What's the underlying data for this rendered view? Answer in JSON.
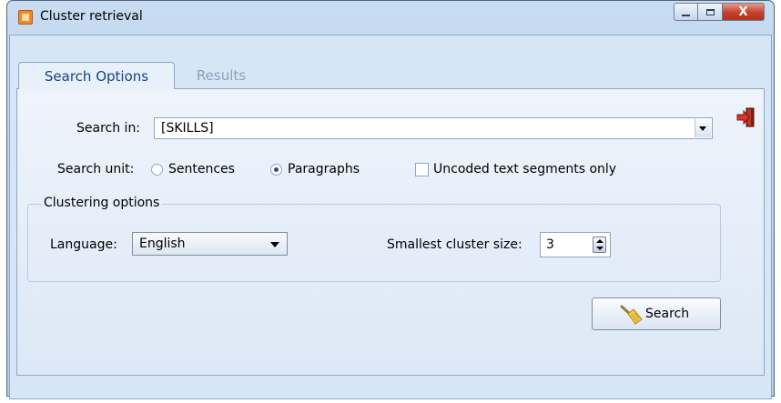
{
  "window": {
    "title": "Cluster retrieval",
    "close_glyph": "X"
  },
  "tabs": [
    {
      "label": "Search Options",
      "active": true
    },
    {
      "label": "Results",
      "active": false
    }
  ],
  "search_in": {
    "label": "Search in:",
    "value": "[SKILLS]"
  },
  "search_unit": {
    "label": "Search unit:",
    "options": [
      {
        "label": "Sentences",
        "checked": false
      },
      {
        "label": "Paragraphs",
        "checked": true
      }
    ],
    "uncoded_label": "Uncoded text segments only",
    "uncoded_checked": false
  },
  "clustering": {
    "title": "Clustering options",
    "language_label": "Language:",
    "language_value": "English",
    "size_label": "Smallest cluster size:",
    "size_value": "3"
  },
  "actions": {
    "search_label": "Search"
  },
  "icons": {
    "app": "app-icon",
    "exit": "exit-icon",
    "search": "broom-icon"
  }
}
